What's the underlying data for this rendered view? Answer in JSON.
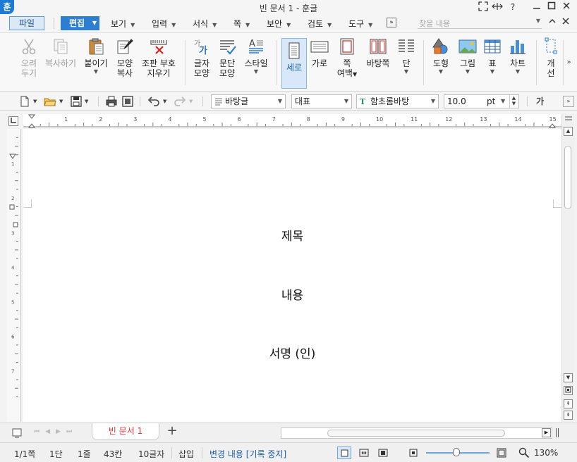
{
  "window": {
    "title": "빈 문서 1 - 훈글",
    "logo": "훈"
  },
  "menu": {
    "file": "파일",
    "edit": "편집",
    "items": [
      "보기",
      "입력",
      "서식",
      "쪽",
      "보안",
      "검토",
      "도구"
    ],
    "more": "»",
    "find_placeholder": "찾을 내용"
  },
  "ribbon": {
    "cut": [
      "오려",
      "두기"
    ],
    "copy": "복사하기",
    "paste": "붙이기",
    "format_copy": [
      "모양",
      "복사"
    ],
    "remove_codes": [
      "조판 부호",
      "지우기"
    ],
    "char_shape": [
      "글자",
      "모양"
    ],
    "para_shape": [
      "문단",
      "모양"
    ],
    "style": "스타일",
    "portrait": "세로",
    "landscape": "가로",
    "margins": [
      "쪽",
      "여백"
    ],
    "master_page": "바탕쪽",
    "columns": "단",
    "shape": "도형",
    "picture": "그림",
    "table": "표",
    "chart": "차트",
    "object_select": [
      "개",
      "선"
    ]
  },
  "format_toolbar": {
    "style_value": "바탕글",
    "lang_value": "대표",
    "font_value": "함초롬바탕",
    "font_size": "10.0",
    "size_unit": "pt",
    "char_btn": "가"
  },
  "ruler": {
    "h_numbers": [
      "1",
      "2",
      "3",
      "4",
      "5",
      "6",
      "7",
      "8",
      "9",
      "10",
      "11",
      "12",
      "13",
      "14",
      "15"
    ],
    "v_numbers": [
      "1",
      "2",
      "3",
      "4",
      "5",
      "6",
      "7"
    ]
  },
  "document": {
    "lines": [
      "제목",
      "내용",
      "서명 (인)"
    ]
  },
  "tabs": {
    "doc_tab": "빈 문서 1",
    "add": "+"
  },
  "status": {
    "page": "1/1쪽",
    "column": "1단",
    "line": "1줄",
    "col_pos": "43칸",
    "chars": "10글자",
    "mode": "삽입",
    "track_changes": "변경 내용 [기록 중지]",
    "zoom": "130%",
    "zoom_level": 0.48
  },
  "colors": {
    "accent": "#2d7dd2",
    "tab_text": "#dd3333"
  }
}
